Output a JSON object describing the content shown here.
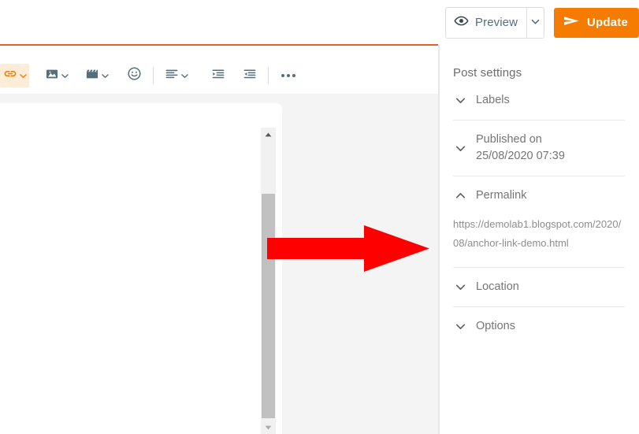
{
  "topbar": {
    "preview_label": "Preview",
    "preview_icon": "eye-icon",
    "preview_caret_icon": "chevron-down-icon",
    "update_label": "Update",
    "update_icon": "send-icon",
    "update_color": "#f57c00"
  },
  "toolbar": {
    "items": [
      {
        "name": "link",
        "icon": "link-icon",
        "has_caret": true,
        "active": true
      },
      {
        "name": "image",
        "icon": "image-icon",
        "has_caret": true,
        "active": false
      },
      {
        "name": "video",
        "icon": "video-icon",
        "has_caret": true,
        "active": false
      },
      {
        "name": "emoji",
        "icon": "emoji-icon",
        "has_caret": false,
        "active": false
      },
      {
        "name": "align",
        "icon": "align-left-icon",
        "has_caret": true,
        "active": false
      },
      {
        "name": "indent-increase",
        "icon": "indent-increase-icon",
        "has_caret": false,
        "active": false
      },
      {
        "name": "indent-decrease",
        "icon": "indent-decrease-icon",
        "has_caret": false,
        "active": false
      },
      {
        "name": "more",
        "icon": "more-horizontal-icon",
        "has_caret": false,
        "active": false
      }
    ]
  },
  "editor": {
    "title_underline_color": "#ef5a29",
    "body_text": "",
    "scrollbar": {
      "up_icon": "scroll-up-arrow-icon",
      "down_icon": "scroll-down-arrow-icon"
    }
  },
  "annotation": {
    "arrow_icon": "red-right-arrow-icon",
    "arrow_color": "#fe0000"
  },
  "sidebar": {
    "title": "Post settings",
    "sections": [
      {
        "label": "Labels",
        "chevron": "chevron-down-icon",
        "expanded": false
      },
      {
        "label": "Published on 25/08/2020 07:39",
        "label_line1": "Published on",
        "label_line2": "25/08/2020 07:39",
        "chevron": "chevron-down-icon",
        "expanded": false
      },
      {
        "label": "Permalink",
        "chevron": "chevron-up-icon",
        "expanded": true,
        "url": "https://demolab1.blogspot.com/2020/08/anchor-link-demo.html"
      },
      {
        "label": "Location",
        "chevron": "chevron-down-icon",
        "expanded": false
      },
      {
        "label": "Options",
        "chevron": "chevron-down-icon",
        "expanded": false
      }
    ]
  }
}
